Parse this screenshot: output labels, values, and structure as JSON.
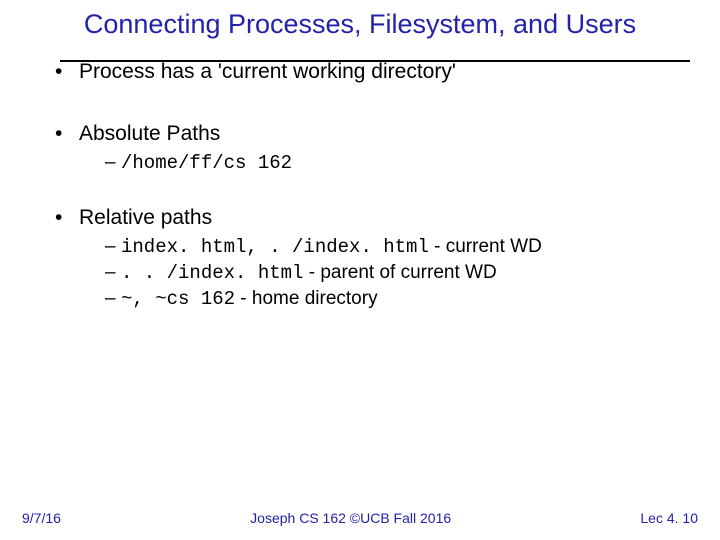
{
  "title": "Connecting Processes, Filesystem, and Users",
  "bullets": {
    "b1": "Process has a 'current working directory'",
    "b2": "Absolute Paths",
    "b2_sub1": "/home/ff/cs 162",
    "b3": "Relative paths",
    "b3_sub1_code": "index. html, . /index. html",
    "b3_sub1_note": "   - current WD",
    "b3_sub2_code": ". . /index. html",
    "b3_sub2_note": "   - parent of current WD",
    "b3_sub3_code": "~, ~cs 162",
    "b3_sub3_note": "   - home directory"
  },
  "footer": {
    "left": "9/7/16",
    "center": "Joseph CS 162 ©UCB Fall 2016",
    "right": "Lec 4. 10"
  }
}
